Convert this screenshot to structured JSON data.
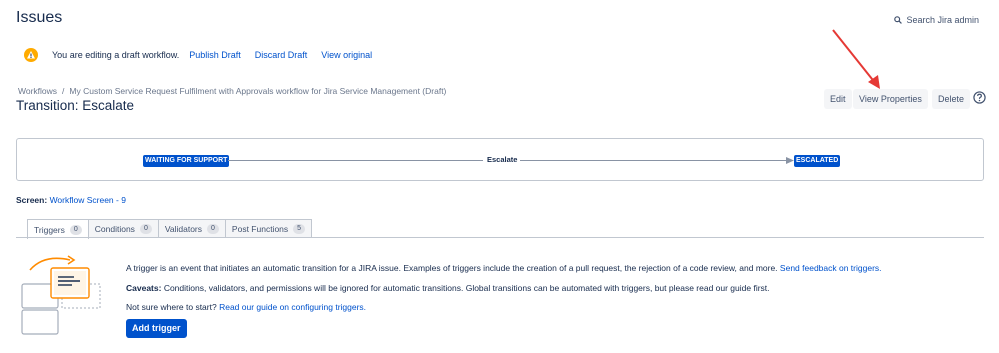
{
  "header": {
    "title": "Issues",
    "search_label": "Search Jira admin"
  },
  "draft_bar": {
    "message": "You are editing a draft workflow.",
    "publish": "Publish Draft",
    "discard": "Discard Draft",
    "view_original": "View original"
  },
  "breadcrumb": {
    "root": "Workflows",
    "separator": "/",
    "workflow": "My Custom Service Request Fulfilment with Approvals workflow for Jira Service Management (Draft)"
  },
  "page": {
    "title": "Transition: Escalate"
  },
  "actions": {
    "edit": "Edit",
    "view_properties": "View Properties",
    "delete": "Delete"
  },
  "diagram": {
    "from_status": "WAITING FOR SUPPORT",
    "transition": "Escalate",
    "to_status": "ESCALATED",
    "status_color": "#0052cc"
  },
  "screen": {
    "label": "Screen:",
    "value": "Workflow Screen - 9"
  },
  "tabs": [
    {
      "label": "Triggers",
      "count": "0"
    },
    {
      "label": "Conditions",
      "count": "0"
    },
    {
      "label": "Validators",
      "count": "0"
    },
    {
      "label": "Post Functions",
      "count": "5"
    }
  ],
  "triggers": {
    "intro": "A trigger is an event that initiates an automatic transition for a JIRA issue. Examples of triggers include the creation of a pull request, the rejection of a code review, and more.",
    "feedback_link": "Send feedback on triggers.",
    "caveats_label": "Caveats:",
    "caveats_text": "Conditions, validators, and permissions will be ignored for automatic transitions. Global transitions can be automated with triggers, but please read our guide first.",
    "start_text": "Not sure where to start?",
    "guide_link": "Read our guide on configuring triggers.",
    "add_button": "Add trigger"
  },
  "annotation_color": "#e53935"
}
